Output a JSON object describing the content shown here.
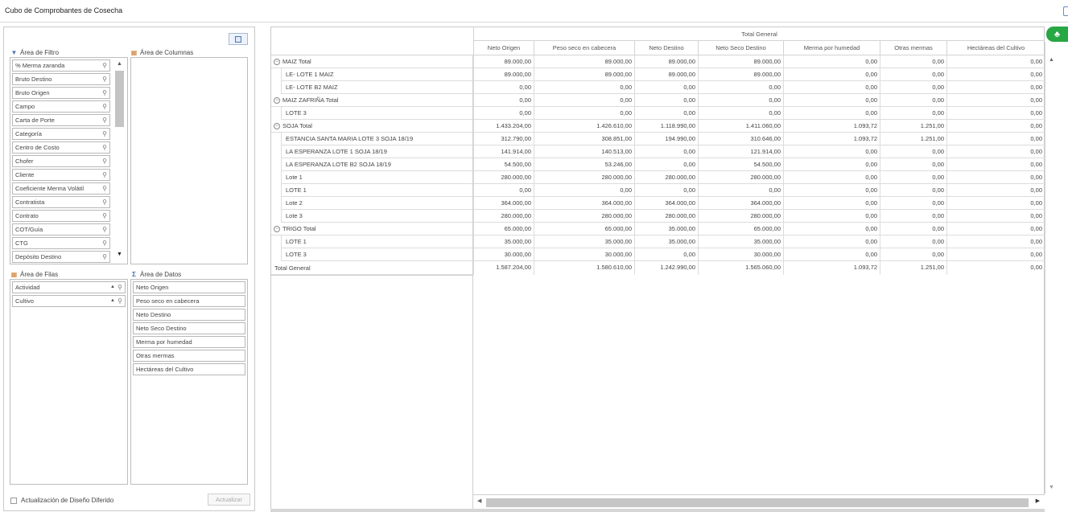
{
  "window": {
    "title": "Cubo de Comprobantes de Cosecha"
  },
  "field_list": {
    "filter_area_label": "Área de Filtro",
    "columns_area_label": "Área de Columnas",
    "rows_area_label": "Área de Filas",
    "data_area_label": "Área de Datos",
    "filter_fields": [
      "% Merma zaranda",
      "Bruto Destino",
      "Bruto Origen",
      "Campo",
      "Carta de Porte",
      "Categoría",
      "Centro de Costo",
      "Chofer",
      "Cliente",
      "Coeficiente Merma Volátil",
      "Contratista",
      "Contrato",
      "COT/Guía",
      "CTG",
      "Depósito Destino"
    ],
    "row_fields": [
      "Actividad",
      "Cultivo"
    ],
    "data_fields": [
      "Neto Origen",
      "Peso seco en cabecera",
      "Neto Destino",
      "Neto Seco Destino",
      "Merma por humedad",
      "Otras mermas",
      "Hectáreas del Cultivo"
    ],
    "deferred_label": "Actualización de Diseño Diferido",
    "update_button": "Actualizar"
  },
  "pivot": {
    "total_header": "Total General",
    "columns": [
      "Neto Origen",
      "Peso seco en cabecera",
      "Neto Destino",
      "Neto Seco Destino",
      "Merma por humedad",
      "Otras mermas",
      "Hectáreas del Cultivo"
    ],
    "rows": [
      {
        "label": "MAIZ Total",
        "group": true,
        "values": [
          "89.000,00",
          "89.000,00",
          "89.000,00",
          "89.000,00",
          "0,00",
          "0,00",
          "0,00"
        ]
      },
      {
        "label": "LE- LOTE 1 MAIZ",
        "group": false,
        "values": [
          "89.000,00",
          "89.000,00",
          "89.000,00",
          "89.000,00",
          "0,00",
          "0,00",
          "0,00"
        ]
      },
      {
        "label": "LE- LOTE B2 MAIZ",
        "group": false,
        "values": [
          "0,00",
          "0,00",
          "0,00",
          "0,00",
          "0,00",
          "0,00",
          "0,00"
        ]
      },
      {
        "label": "MAIZ ZAFRIÑA Total",
        "group": true,
        "values": [
          "0,00",
          "0,00",
          "0,00",
          "0,00",
          "0,00",
          "0,00",
          "0,00"
        ]
      },
      {
        "label": "LOTE 3",
        "group": false,
        "values": [
          "0,00",
          "0,00",
          "0,00",
          "0,00",
          "0,00",
          "0,00",
          "0,00"
        ]
      },
      {
        "label": "SOJA Total",
        "group": true,
        "values": [
          "1.433.204,00",
          "1.426.610,00",
          "1.118.990,00",
          "1.411.060,00",
          "1.093,72",
          "1.251,00",
          "0,00"
        ]
      },
      {
        "label": "ESTANCIA SANTA MARIA LOTE 3 SOJA 18/19",
        "group": false,
        "values": [
          "312.790,00",
          "308.851,00",
          "194.990,00",
          "310.646,00",
          "1.093,72",
          "1.251,00",
          "0,00"
        ]
      },
      {
        "label": "LA ESPERANZA LOTE 1 SOJA 18/19",
        "group": false,
        "values": [
          "141.914,00",
          "140.513,00",
          "0,00",
          "121.914,00",
          "0,00",
          "0,00",
          "0,00"
        ]
      },
      {
        "label": "LA ESPERANZA LOTE B2 SOJA 18/19",
        "group": false,
        "values": [
          "54.500,00",
          "53.246,00",
          "0,00",
          "54.500,00",
          "0,00",
          "0,00",
          "0,00"
        ]
      },
      {
        "label": "Lote 1",
        "group": false,
        "values": [
          "280.000,00",
          "280.000,00",
          "280.000,00",
          "280.000,00",
          "0,00",
          "0,00",
          "0,00"
        ]
      },
      {
        "label": "LOTE 1",
        "group": false,
        "values": [
          "0,00",
          "0,00",
          "0,00",
          "0,00",
          "0,00",
          "0,00",
          "0,00"
        ]
      },
      {
        "label": "Lote 2",
        "group": false,
        "values": [
          "364.000,00",
          "364.000,00",
          "364.000,00",
          "364.000,00",
          "0,00",
          "0,00",
          "0,00"
        ]
      },
      {
        "label": "Lote 3",
        "group": false,
        "values": [
          "280.000,00",
          "280.000,00",
          "280.000,00",
          "280.000,00",
          "0,00",
          "0,00",
          "0,00"
        ]
      },
      {
        "label": "TRIGO Total",
        "group": true,
        "values": [
          "65.000,00",
          "65.000,00",
          "35.000,00",
          "65.000,00",
          "0,00",
          "0,00",
          "0,00"
        ]
      },
      {
        "label": "LOTE 1",
        "group": false,
        "values": [
          "35.000,00",
          "35.000,00",
          "35.000,00",
          "35.000,00",
          "0,00",
          "0,00",
          "0,00"
        ]
      },
      {
        "label": "LOTE 3",
        "group": false,
        "values": [
          "30.000,00",
          "30.000,00",
          "0,00",
          "30.000,00",
          "0,00",
          "0,00",
          "0,00"
        ]
      },
      {
        "label": "Total General",
        "group": "grand",
        "values": [
          "1.587.204,00",
          "1.580.610,00",
          "1.242.990,00",
          "1.565.060,00",
          "1.093,72",
          "1.251,00",
          "0,00"
        ]
      }
    ]
  }
}
